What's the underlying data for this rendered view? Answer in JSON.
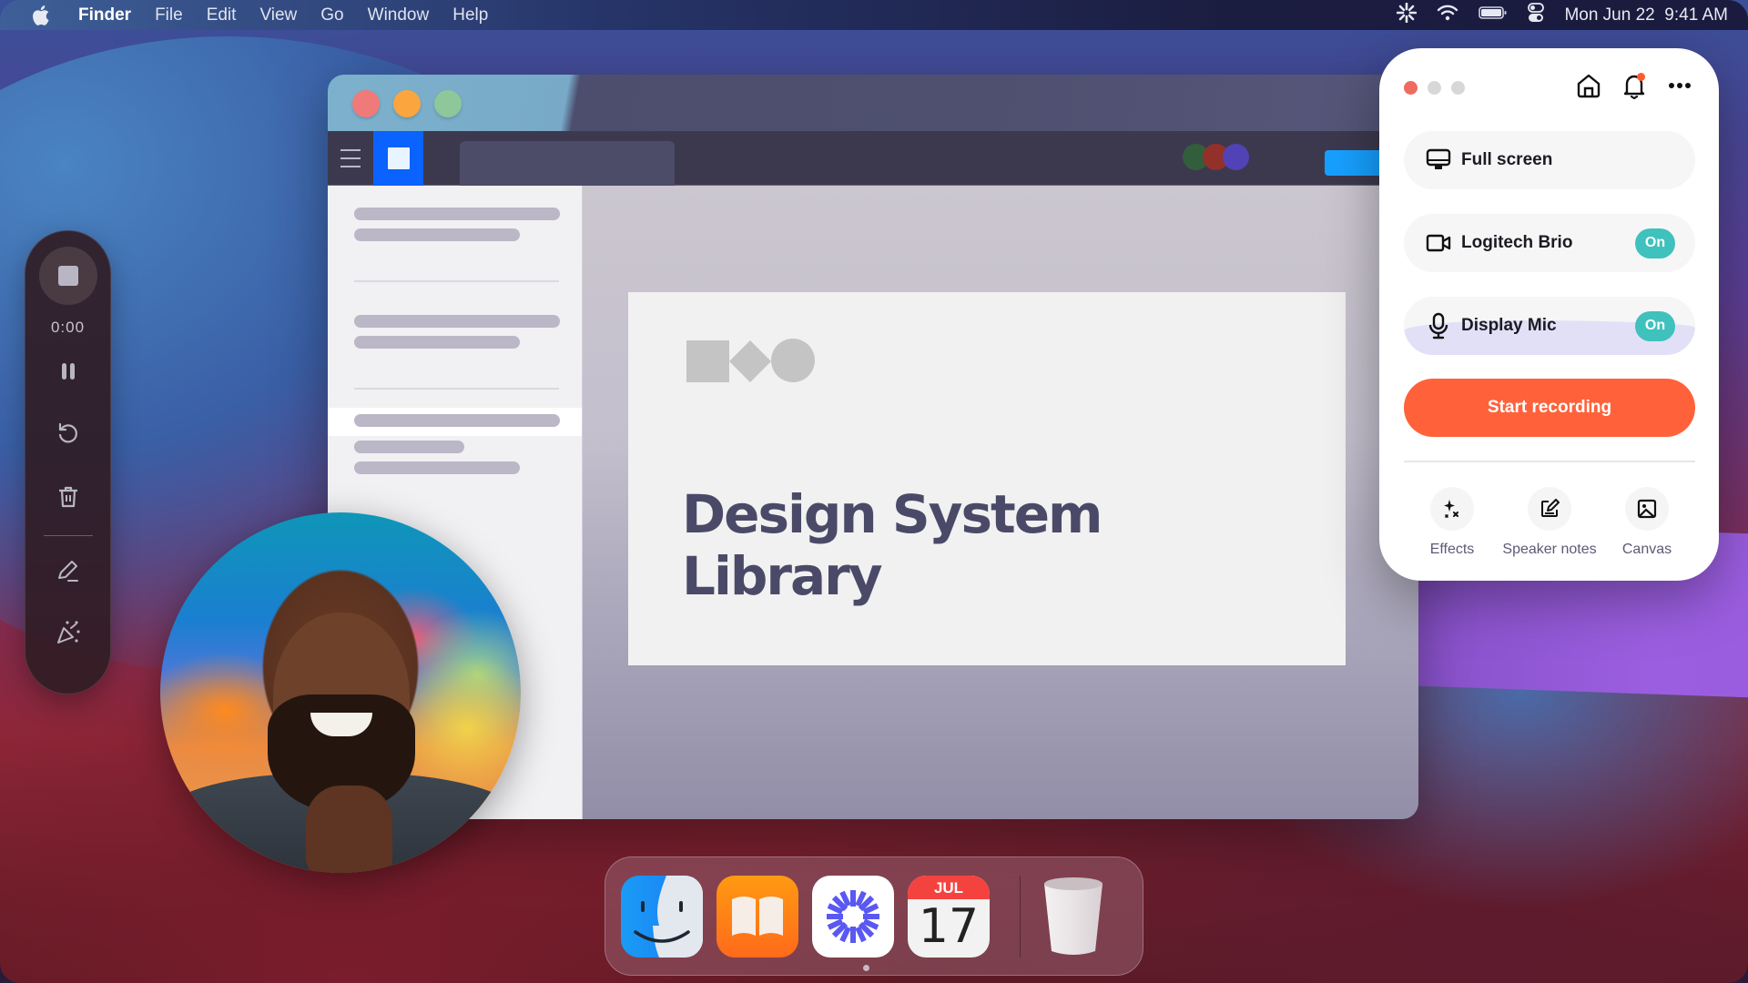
{
  "menubar": {
    "apple_icon": "apple-logo-icon",
    "app_name": "Finder",
    "items": [
      "File",
      "Edit",
      "View",
      "Go",
      "Window",
      "Help"
    ],
    "status_icons": [
      "loom-icon",
      "wifi-icon",
      "battery-icon",
      "control-center-icon"
    ],
    "clock": "Mon Jun 22  9:41 AM"
  },
  "window": {
    "collaborator_colors": [
      "#335e3c",
      "#933029",
      "#5143b5"
    ],
    "slide": {
      "logo_shapes": [
        "square",
        "diamond",
        "circle"
      ],
      "title_line1": "Design System",
      "title_line2": "Library"
    }
  },
  "recording_controls": {
    "timer": "0:00",
    "buttons": [
      "stop",
      "pause",
      "restart",
      "delete",
      "draw",
      "effects"
    ]
  },
  "recorder": {
    "header_icons": [
      "home-icon",
      "bell-icon",
      "more-icon"
    ],
    "notification_dot": true,
    "rows": [
      {
        "icon": "monitor-icon",
        "label": "Full screen"
      },
      {
        "icon": "camera-icon",
        "label": "Logitech Brio",
        "toggle": "On"
      },
      {
        "icon": "microphone-icon",
        "label": "Display Mic",
        "toggle": "On"
      }
    ],
    "start_button": "Start recording",
    "tools": [
      {
        "icon": "sparkles-icon",
        "label": "Effects"
      },
      {
        "icon": "edit-note-icon",
        "label": "Speaker notes"
      },
      {
        "icon": "image-icon",
        "label": "Canvas"
      }
    ],
    "accent_color": "#ff623a",
    "toggle_color": "#3fc1bd"
  },
  "dock": {
    "apps": [
      {
        "name": "Finder"
      },
      {
        "name": "Books"
      },
      {
        "name": "Loom"
      },
      {
        "name": "Calendar",
        "month": "JUL",
        "day": "17"
      },
      {
        "name": "Trash"
      }
    ]
  }
}
